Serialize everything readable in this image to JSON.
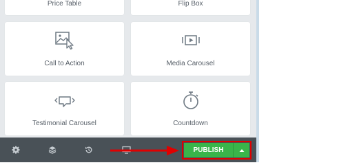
{
  "widgets": [
    {
      "label": "Price Table",
      "icon": "price-table-icon"
    },
    {
      "label": "Flip Box",
      "icon": "flip-box-icon"
    },
    {
      "label": "Call to Action",
      "icon": "call-to-action-icon"
    },
    {
      "label": "Media Carousel",
      "icon": "media-carousel-icon"
    },
    {
      "label": "Testimonial Carousel",
      "icon": "testimonial-carousel-icon"
    },
    {
      "label": "Countdown",
      "icon": "countdown-icon"
    }
  ],
  "footer": {
    "publish_label": "PUBLISH",
    "tools": [
      "settings-icon",
      "layers-icon",
      "history-icon",
      "responsive-mode-icon"
    ],
    "publish_color": "#39b54a",
    "highlight_color": "#e00000"
  }
}
